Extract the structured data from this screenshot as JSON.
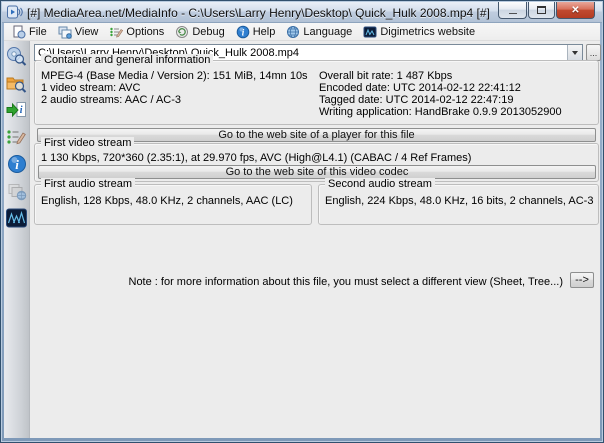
{
  "window": {
    "title": "[#] MediaArea.net/MediaInfo - C:\\Users\\Larry Henry\\Desktop\\ Quick_Hulk 2008.mp4 [#]",
    "minimize_glyph": "—",
    "close_glyph": "✕"
  },
  "menu": {
    "items": [
      {
        "label": "File",
        "icon": "file-menu-icon"
      },
      {
        "label": "View",
        "icon": "view-menu-icon"
      },
      {
        "label": "Options",
        "icon": "options-menu-icon"
      },
      {
        "label": "Debug",
        "icon": "debug-menu-icon"
      },
      {
        "label": "Help",
        "icon": "help-menu-icon"
      },
      {
        "label": "Language",
        "icon": "language-menu-icon"
      },
      {
        "label": "Digimetrics website",
        "icon": "digimetrics-menu-icon"
      }
    ]
  },
  "toolbar": {
    "path_value": "C:\\Users\\Larry Henry\\Desktop\\ Quick_Hulk 2008.mp4",
    "browse_label": "..."
  },
  "sidebar": {
    "items": [
      {
        "name": "open-file",
        "icon": "disc-search-icon"
      },
      {
        "name": "open-folder",
        "icon": "folder-search-icon"
      },
      {
        "name": "export",
        "icon": "export-info-icon"
      },
      {
        "name": "options",
        "icon": "options-list-icon"
      },
      {
        "name": "about",
        "icon": "info-icon"
      },
      {
        "name": "website",
        "icon": "web-folder-icon"
      },
      {
        "name": "digimetrics",
        "icon": "waveform-icon"
      }
    ]
  },
  "general": {
    "title": "Container and general information",
    "left_lines": [
      "MPEG-4 (Base Media / Version 2): 151 MiB, 14mn 10s",
      "1 video stream: AVC",
      "2 audio streams: AAC / AC-3"
    ],
    "right_lines": [
      "Overall bit rate: 1 487 Kbps",
      "Encoded date: UTC 2014-02-12 22:41:12",
      "Tagged date: UTC 2014-02-12 22:47:19",
      "Writing application: HandBrake 0.9.9 2013052900"
    ]
  },
  "buttons": {
    "player_site": "Go to the web site of a player for this file",
    "codec_site": "Go to the web site of this video codec",
    "note_arrow": "-->"
  },
  "video": {
    "title": "First video stream",
    "info": "1 130 Kbps, 720*360 (2.35:1), at 29.970 fps, AVC (High@L4.1) (CABAC / 4 Ref Frames)"
  },
  "audio_first": {
    "title": "First audio stream",
    "info": "English, 128 Kbps, 48.0 KHz, 2 channels, AAC (LC)"
  },
  "audio_second": {
    "title": "Second audio stream",
    "info": "English, 224 Kbps, 48.0 KHz, 16 bits, 2 channels, AC-3"
  },
  "note": {
    "text": "Note : for more information about this file, you must select a different view (Sheet, Tree...)"
  },
  "colors": {
    "accent_blue": "#2f7fd0",
    "close_red": "#c14a30",
    "content_bg": "#ececec"
  }
}
